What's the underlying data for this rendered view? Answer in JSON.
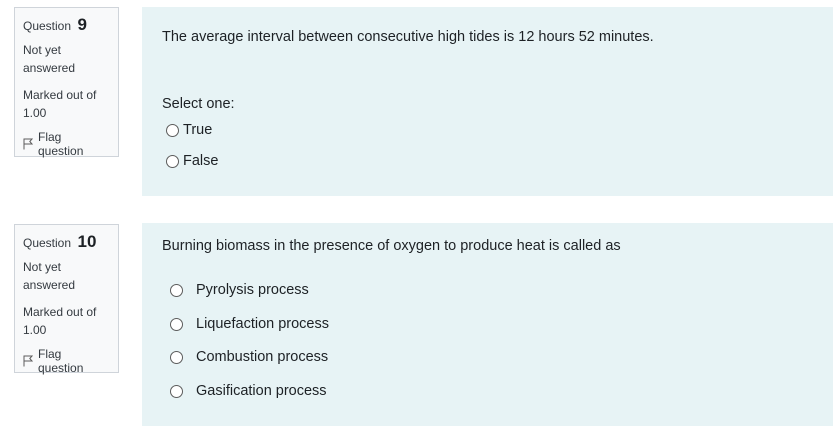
{
  "questions": [
    {
      "label": "Question",
      "number": "9",
      "state": "Not yet answered",
      "grade": "Marked out of 1.00",
      "flag_label": "Flag question",
      "text": "The average interval between consecutive high tides is 12 hours 52 minutes.",
      "prompt": "Select one:",
      "options": [
        "True",
        "False"
      ]
    },
    {
      "label": "Question",
      "number": "10",
      "state": "Not yet answered",
      "grade": "Marked out of 1.00",
      "flag_label": "Flag question",
      "text": "Burning biomass in the presence of oxygen to produce heat is called as",
      "options": [
        "Pyrolysis process",
        "Liquefaction process",
        "Combustion process",
        "Gasification process"
      ]
    }
  ]
}
